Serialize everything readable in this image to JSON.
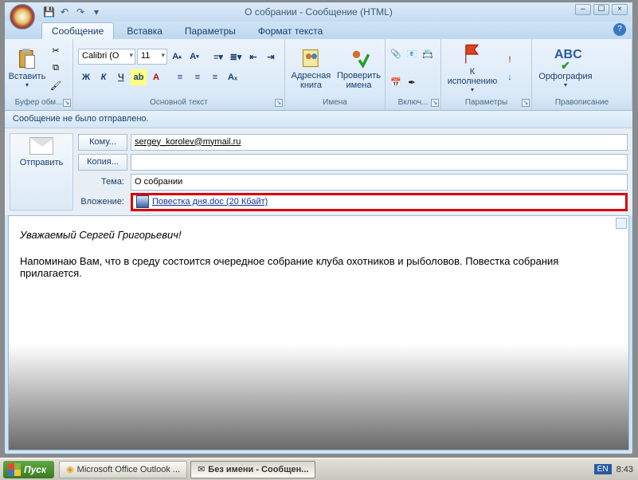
{
  "title": "О собрании - Сообщение (HTML)",
  "qat": {
    "save": "💾",
    "undo": "↶",
    "redo": "↷",
    "more": "▾"
  },
  "tabs": {
    "t1": "Сообщение",
    "t2": "Вставка",
    "t3": "Параметры",
    "t4": "Формат текста"
  },
  "ribbon": {
    "clipboard": {
      "paste": "Вставить",
      "label": "Буфер обм..."
    },
    "font": {
      "name": "Calibri (О",
      "size": "11",
      "label": "Основной текст"
    },
    "names": {
      "ab": "Адресная книга",
      "check": "Проверить имена",
      "label": "Имена"
    },
    "include": {
      "label": "Включ..."
    },
    "followup": {
      "btn": "К исполнению",
      "label": "Параметры"
    },
    "spelling": {
      "btn": "Орфография",
      "label": "Правописание"
    }
  },
  "infobar": "Сообщение не было отправлено.",
  "header": {
    "send": "Отправить",
    "to_btn": "Кому...",
    "cc_btn": "Копия...",
    "subject_lbl": "Тема:",
    "attach_lbl": "Вложение:",
    "to_val": "sergey_korolev@mymail.ru",
    "cc_val": "",
    "subject_val": "О собрании",
    "attach_val": "Повестка дня.doc (20 Кбайт)"
  },
  "body": {
    "greeting": "Уважаемый Сергей Григорьевич!",
    "text": "Напоминаю  Вам, что в среду состоится очередное собрание клуба охотников и рыболовов. Повестка собрания прилагается."
  },
  "taskbar": {
    "start": "Пуск",
    "b1": "Microsoft Office Outlook ...",
    "b2": "Без имени - Сообщен...",
    "lang": "EN",
    "clock": "8:43"
  }
}
